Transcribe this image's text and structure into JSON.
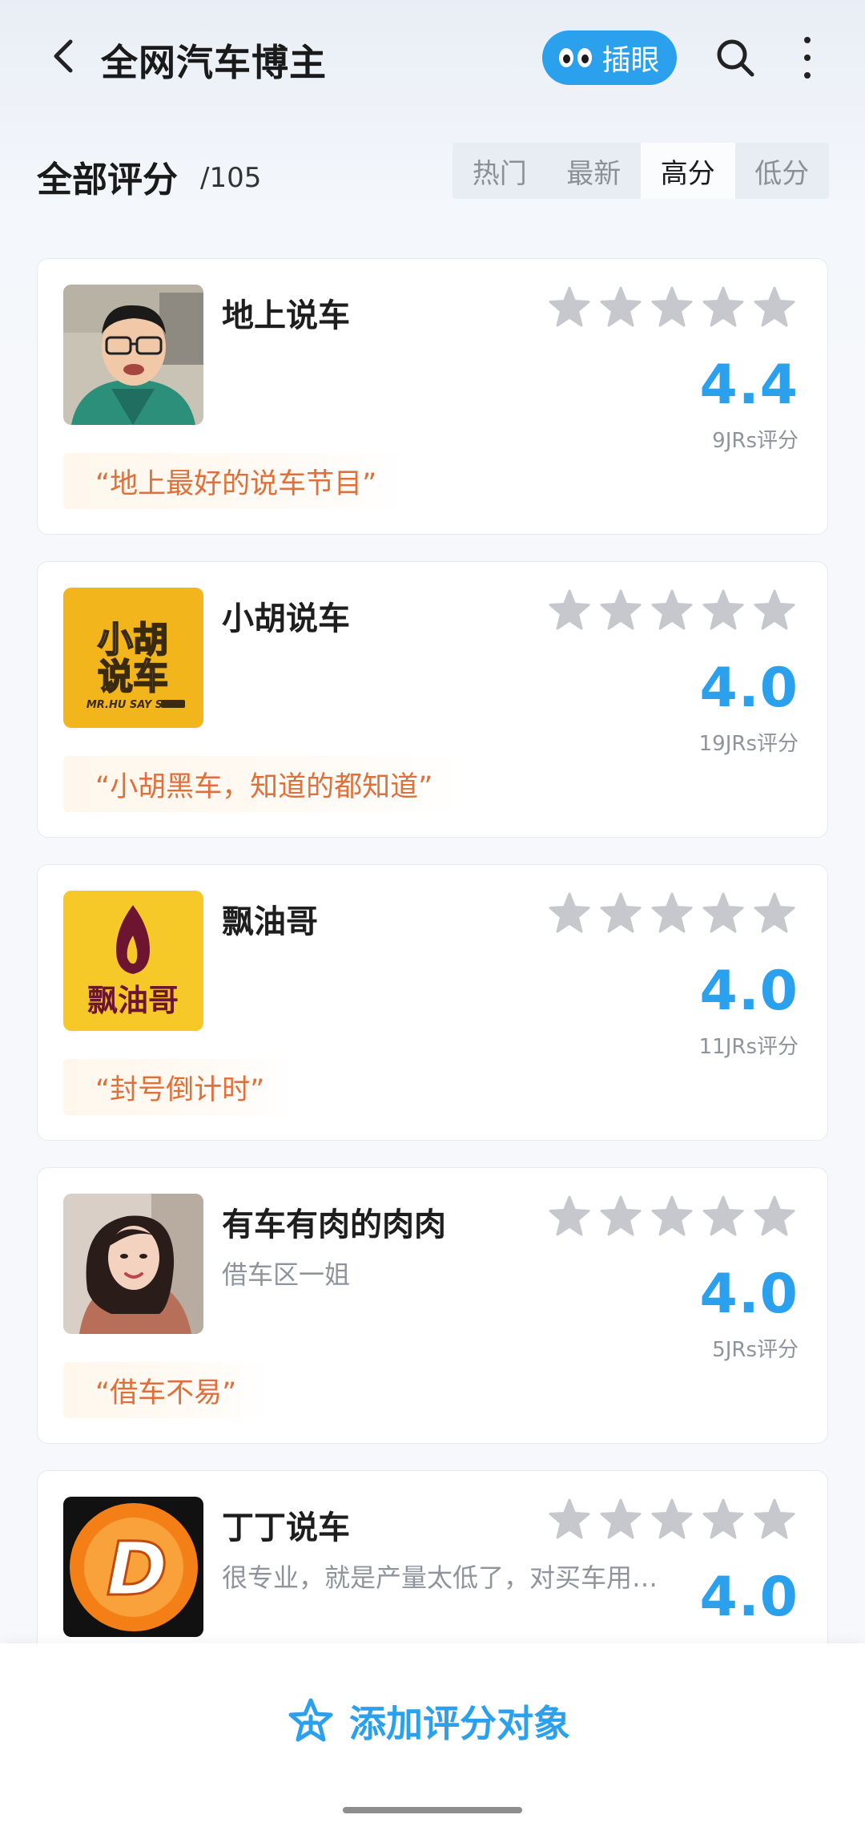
{
  "header": {
    "title": "全网汽车博主",
    "pill_label": "插眼"
  },
  "filter": {
    "title": "全部评分",
    "count": "/105",
    "tabs": [
      "热门",
      "最新",
      "高分",
      "低分"
    ],
    "active_tab": "高分"
  },
  "items": [
    {
      "name": "地上说车",
      "subtitle": "",
      "score": "4.4",
      "ratings": "9JRs评分",
      "quote": "“地上最好的说车节目”",
      "avatar": "portrait-man"
    },
    {
      "name": "小胡说车",
      "subtitle": "",
      "score": "4.0",
      "ratings": "19JRs评分",
      "quote": "“小胡黑车，知道的都知道”",
      "avatar": "logo-xiaohu",
      "logo_text": {
        "line1": "小胡",
        "line2": "说车",
        "tag": "MR.HU SAY SO"
      }
    },
    {
      "name": "飘油哥",
      "subtitle": "",
      "score": "4.0",
      "ratings": "11JRs评分",
      "quote": "“封号倒计时”",
      "avatar": "logo-piaoyouge",
      "logo_text": {
        "line1": "飘油哥"
      }
    },
    {
      "name": "有车有肉的肉肉",
      "subtitle": "借车区一姐",
      "score": "4.0",
      "ratings": "5JRs评分",
      "quote": "“借车不易”",
      "avatar": "portrait-woman"
    },
    {
      "name": "丁丁说车",
      "subtitle": "很专业，就是产量太低了，对买车用…",
      "score": "4.0",
      "ratings": "",
      "quote": "",
      "avatar": "logo-d",
      "logo_text": {
        "line1": "D"
      }
    }
  ],
  "bottom": {
    "add_label": "添加评分对象"
  },
  "colors": {
    "accent": "#2ba1ee",
    "quote_text": "#e0703a",
    "star": "#c6c8ce"
  }
}
